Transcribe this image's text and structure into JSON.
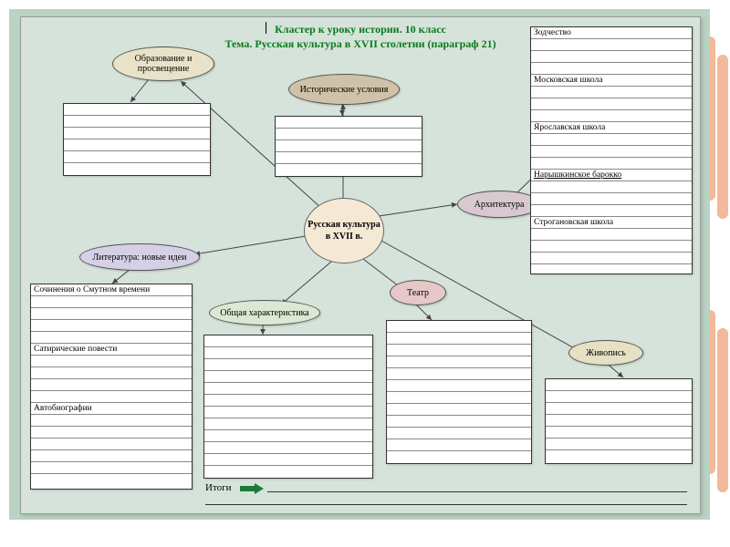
{
  "title1": "Кластер к уроку истории. 10 класс",
  "title2": "Тема. Русская культура в XVII столетии (параграф 21)",
  "central": "Русская культура в XVII  в.",
  "nodes": {
    "education": "Образование и просвещение",
    "conditions": "Исторические условия",
    "architecture": "Архитектура",
    "literature": "Литература: новые идеи",
    "theatre": "Театр",
    "general": "Общая характеристика",
    "painting": "Живопись"
  },
  "lit_headers": {
    "h1": "Сочинения о Смутном времени",
    "h2": "Сатирические повести",
    "h3": "Автобиографии"
  },
  "arch_headers": {
    "h1": "Зодчество",
    "h2": "Московская школа",
    "h3": "Ярославская школа",
    "h4": "Нарышкинское барокко",
    "h5": "Строгановская школа"
  },
  "footer": "Итоги",
  "colors": {
    "education": "#e8e3c8",
    "conditions": "#cfc2a8",
    "architecture": "#d9c8d0",
    "literature": "#d6d0e6",
    "theatre": "#e6c8c8",
    "general": "#dce8d4",
    "painting": "#e6e0c4"
  }
}
